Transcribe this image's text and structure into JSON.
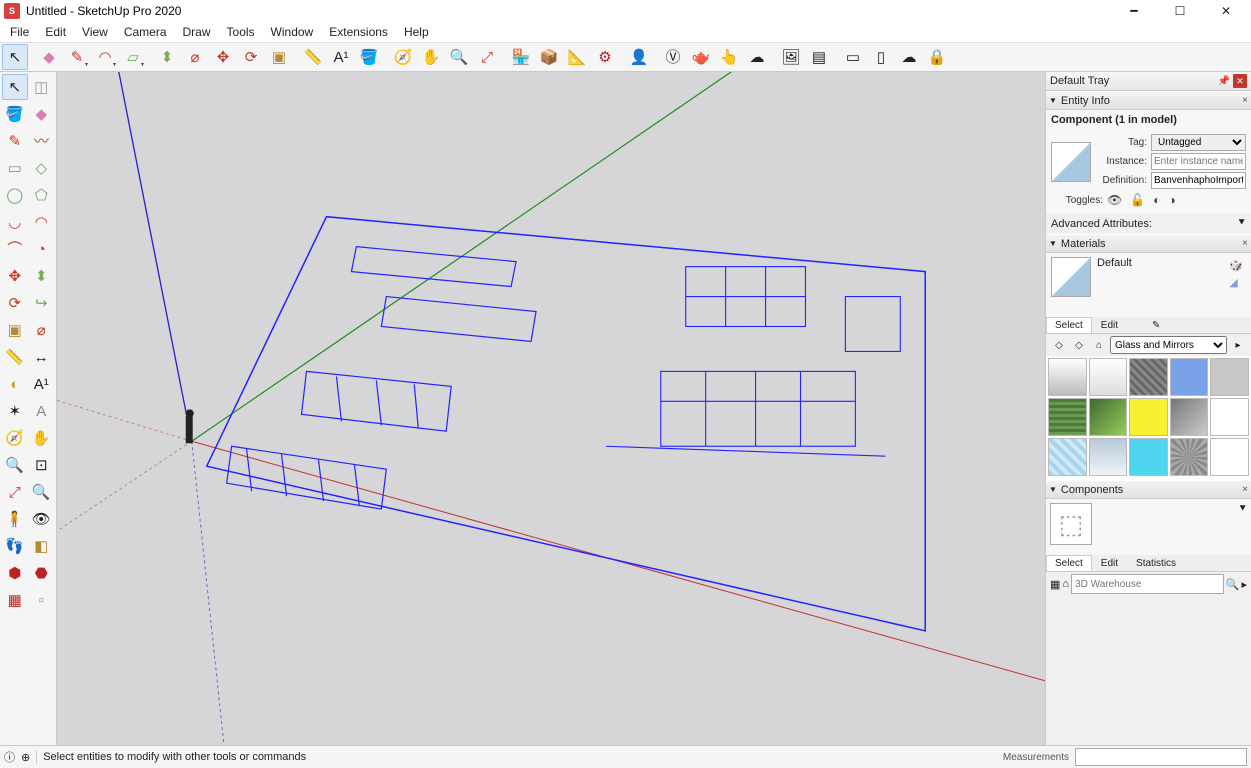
{
  "title": "Untitled - SketchUp Pro 2020",
  "menus": [
    "File",
    "Edit",
    "View",
    "Camera",
    "Draw",
    "Tools",
    "Window",
    "Extensions",
    "Help"
  ],
  "tray": {
    "title": "Default Tray",
    "entity": {
      "header": "Entity Info",
      "summary": "Component (1 in model)",
      "tag_label": "Tag:",
      "tag_value": "Untagged",
      "instance_label": "Instance:",
      "instance_placeholder": "Enter instance name",
      "definition_label": "Definition:",
      "definition_value": "BanvenhaphoImportSke",
      "toggles_label": "Toggles:",
      "advanced": "Advanced Attributes:"
    },
    "materials": {
      "header": "Materials",
      "current": "Default",
      "tab_select": "Select",
      "tab_edit": "Edit",
      "library": "Glass and Mirrors"
    },
    "components": {
      "header": "Components",
      "tab_select": "Select",
      "tab_edit": "Edit",
      "tab_stats": "Statistics",
      "search_placeholder": "3D Warehouse"
    }
  },
  "status": {
    "hint": "Select entities to modify with other tools or commands",
    "measure_label": "Measurements"
  },
  "mat_colors": [
    "linear-gradient(#fff,#bbb)",
    "linear-gradient(#fff,#ddd)",
    "repeating-linear-gradient(45deg,#888 0 3px,#666 3px 6px)",
    "#7aa2e8",
    "#c8c8c8",
    "repeating-linear-gradient(#4d7a37 0 3px,#6b9a52 3px 6px)",
    "linear-gradient(135deg,#3d6b2e,#9acb5f)",
    "#f7f134",
    "linear-gradient(135deg,#777,#ccc)",
    "#fff",
    "repeating-linear-gradient(45deg,#a7d5ef 0 4px,#cfe9f5 4px 8px)",
    "linear-gradient(#b8c9d8,#eef3f8)",
    "#51d4f0",
    "repeating-conic-gradient(#aaa 0 10deg,#888 10deg 20deg)",
    "#fff"
  ]
}
